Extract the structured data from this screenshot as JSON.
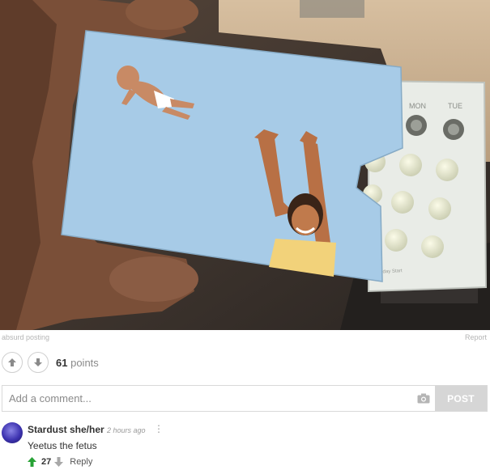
{
  "post": {
    "source": "absurd posting",
    "report_label": "Report",
    "points_value": "61",
    "points_unit": "points",
    "photo": {
      "pack_days": [
        "MON",
        "TUE"
      ],
      "printed_text": "Sunday Start"
    }
  },
  "comment_box": {
    "placeholder": "Add a comment...",
    "post_label": "POST"
  },
  "comment": {
    "author": "Stardust she/her",
    "time": "2 hours ago",
    "more_label": "⋮",
    "text": "Yeetus the fetus",
    "upvotes": "27",
    "reply_label": "Reply"
  },
  "colors": {
    "upvote_green": "#27a235",
    "card_blue": "#a7cbe7",
    "post_button": "#d6d6d6"
  }
}
